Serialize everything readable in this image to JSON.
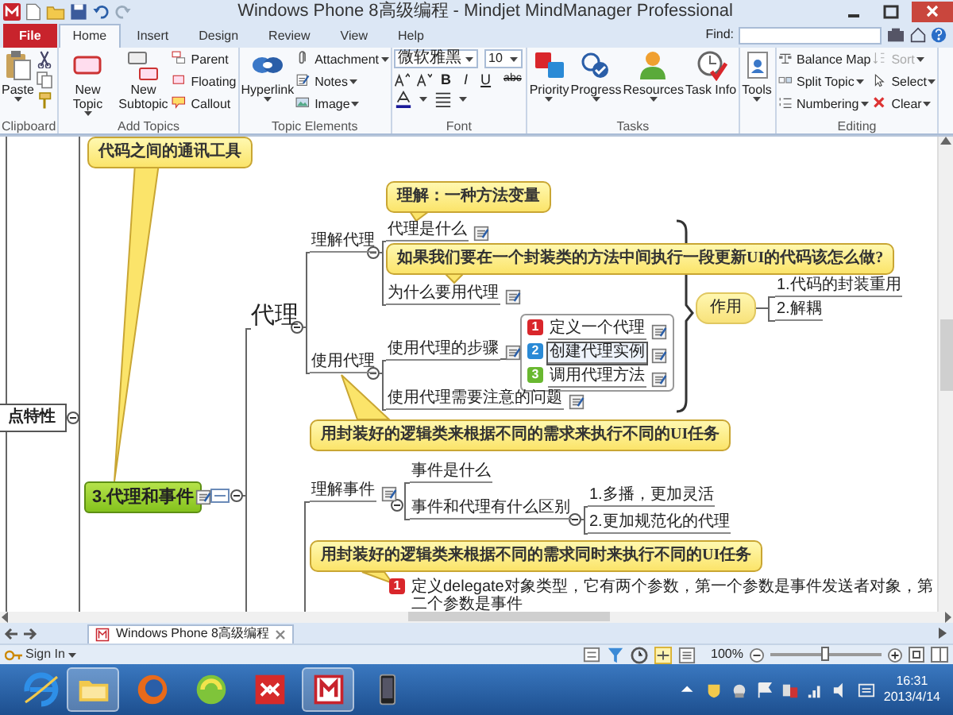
{
  "window": {
    "title": "Windows Phone 8高级编程 - Mindjet MindManager Professional"
  },
  "ribbon_tabs": [
    {
      "label": "File",
      "kind": "backstage",
      "selected": false
    },
    {
      "label": "Home",
      "kind": "tab",
      "selected": true
    },
    {
      "label": "Insert",
      "kind": "tab",
      "selected": false
    },
    {
      "label": "Design",
      "kind": "tab",
      "selected": false
    },
    {
      "label": "Review",
      "kind": "tab",
      "selected": false
    },
    {
      "label": "View",
      "kind": "tab",
      "selected": false
    },
    {
      "label": "Help",
      "kind": "tab",
      "selected": false
    }
  ],
  "find": {
    "label": "Find:"
  },
  "ribbon_groups": [
    {
      "label": "Clipboard",
      "items": [
        {
          "kind": "large",
          "label": "Paste",
          "dropdown": true
        }
      ]
    },
    {
      "label": "Add Topics",
      "items": [
        {
          "kind": "large",
          "label": "New Topic",
          "dropdown": true
        },
        {
          "kind": "large",
          "label": "New Subtopic",
          "dropdown": false
        },
        {
          "kind": "small",
          "label": "Parent",
          "dropdown": false
        },
        {
          "kind": "small",
          "label": "Floating",
          "dropdown": false
        },
        {
          "kind": "small",
          "label": "Callout",
          "dropdown": false
        }
      ]
    },
    {
      "label": "Topic Elements",
      "items": [
        {
          "kind": "large",
          "label": "Hyperlink",
          "dropdown": true
        },
        {
          "kind": "small",
          "label": "Attachment",
          "dropdown": true
        },
        {
          "kind": "small",
          "label": "Notes",
          "dropdown": true
        },
        {
          "kind": "small",
          "label": "Image",
          "dropdown": true
        }
      ]
    },
    {
      "label": "Font",
      "font": "微软雅黑",
      "size": "10",
      "items": [
        {
          "kind": "format",
          "label": "B"
        },
        {
          "kind": "format",
          "label": "I"
        },
        {
          "kind": "format",
          "label": "U"
        },
        {
          "kind": "format",
          "label": "abc"
        }
      ]
    },
    {
      "label": "Tasks",
      "items": [
        {
          "kind": "large",
          "label": "Priority",
          "dropdown": true
        },
        {
          "kind": "large",
          "label": "Progress",
          "dropdown": true
        },
        {
          "kind": "large",
          "label": "Resources",
          "dropdown": true
        },
        {
          "kind": "large",
          "label": "Task Info",
          "dropdown": false
        }
      ]
    },
    {
      "items": [
        {
          "kind": "large",
          "label": "Tools",
          "dropdown": true
        }
      ]
    },
    {
      "label": "Editing",
      "items": [
        {
          "kind": "small",
          "label": "Balance Map",
          "dropdown": false,
          "disabled": false
        },
        {
          "kind": "small",
          "label": "Split Topic",
          "dropdown": true,
          "disabled": false
        },
        {
          "kind": "small",
          "label": "Numbering",
          "dropdown": true,
          "disabled": false
        },
        {
          "kind": "small",
          "label": "Sort",
          "dropdown": true,
          "disabled": true
        },
        {
          "kind": "small",
          "label": "Select",
          "dropdown": true,
          "disabled": false
        },
        {
          "kind": "small",
          "label": "Clear",
          "dropdown": true,
          "disabled": false
        }
      ]
    }
  ],
  "map": {
    "nodes": [
      {
        "kind": "callout",
        "text": "代码之间的通讯工具",
        "note": false
      },
      {
        "kind": "cut",
        "text": "点特性",
        "note": false
      },
      {
        "kind": "main",
        "text": "3.代理和事件",
        "note": true
      },
      {
        "kind": "large",
        "text": "代理",
        "note": false
      },
      {
        "kind": "topic",
        "text": "理解代理",
        "note": false
      },
      {
        "kind": "topic",
        "text": "使用代理",
        "note": false
      },
      {
        "kind": "callout",
        "text": "理解：一种方法变量",
        "note": false
      },
      {
        "kind": "topic",
        "text": "代理是什么",
        "note": true
      },
      {
        "kind": "callout",
        "text": "如果我们要在一个封装类的方法中间执行一段更新UI的代码该怎么做?",
        "note": false
      },
      {
        "kind": "topic",
        "text": "为什么要用代理",
        "note": true
      },
      {
        "kind": "topic",
        "text": "使用代理的步骤",
        "note": true
      },
      {
        "kind": "topic",
        "text": "使用代理需要注意的问题",
        "note": true
      },
      {
        "kind": "step",
        "priority": "1",
        "color": "#d9262b",
        "text": "定义一个代理",
        "note": true,
        "selected": false
      },
      {
        "kind": "step",
        "priority": "2",
        "color": "#2a8ad6",
        "text": "创建代理实例",
        "note": true,
        "selected": true
      },
      {
        "kind": "step",
        "priority": "3",
        "color": "#69b830",
        "text": "调用代理方法",
        "note": true,
        "selected": false
      },
      {
        "kind": "floating",
        "text": "作用",
        "note": false
      },
      {
        "kind": "topic",
        "text": "1.代码的封装重用",
        "note": false
      },
      {
        "kind": "topic",
        "text": "2.解耦",
        "note": false
      },
      {
        "kind": "callout",
        "text": "用封装好的逻辑类来根据不同的需求来执行不同的UI任务",
        "note": false
      },
      {
        "kind": "topic",
        "text": "理解事件",
        "note": true
      },
      {
        "kind": "topic",
        "text": "事件是什么",
        "note": false
      },
      {
        "kind": "topic",
        "text": "事件和代理有什么区别",
        "note": false
      },
      {
        "kind": "topic",
        "text": "1.多播，更加灵活",
        "note": false
      },
      {
        "kind": "topic",
        "text": "2.更加规范化的代理",
        "note": false
      },
      {
        "kind": "callout",
        "text": "用封装好的逻辑类来根据不同的需求同时来执行不同的UI任务",
        "note": false
      },
      {
        "kind": "step",
        "priority": "1",
        "color": "#d9262b",
        "text": "定义delegate对象类型，它有两个参数，第一个参数是事件发送者对象，第二个参数是事件",
        "note": false,
        "selected": false
      }
    ]
  },
  "doc_tab": {
    "label": "Windows Phone 8高级编程",
    "selected": true
  },
  "status_bar": {
    "sign_in": "Sign In",
    "zoom": {
      "reading": "100%",
      "level": 0.5
    }
  },
  "taskbar": {
    "time": "16:31",
    "date": "2013/4/14"
  }
}
